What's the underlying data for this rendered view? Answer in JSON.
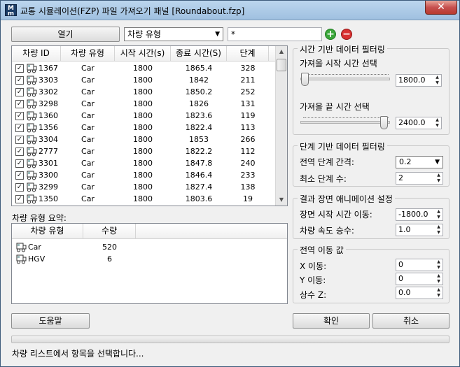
{
  "window": {
    "title": "교통 시뮬레이션(FZP) 파일 가져오기 패널 [Roundabout.fzp]",
    "close": "✕"
  },
  "toolbar": {
    "open_label": "열기",
    "filter_select": "차량 유형",
    "filter_text": "*",
    "add": "+",
    "remove": "−"
  },
  "vehicle_list": {
    "headers": [
      "차량 ID",
      "차량 유형",
      "시작 시간(s)",
      "종료 시간(S)",
      "단계"
    ],
    "rows": [
      {
        "id": "1367",
        "type": "Car",
        "start": "1800",
        "end": "1865.4",
        "steps": "328"
      },
      {
        "id": "3303",
        "type": "Car",
        "start": "1800",
        "end": "1842",
        "steps": "211"
      },
      {
        "id": "3302",
        "type": "Car",
        "start": "1800",
        "end": "1850.2",
        "steps": "252"
      },
      {
        "id": "3298",
        "type": "Car",
        "start": "1800",
        "end": "1826",
        "steps": "131"
      },
      {
        "id": "1360",
        "type": "Car",
        "start": "1800",
        "end": "1823.6",
        "steps": "119"
      },
      {
        "id": "1356",
        "type": "Car",
        "start": "1800",
        "end": "1822.4",
        "steps": "113"
      },
      {
        "id": "3304",
        "type": "Car",
        "start": "1800",
        "end": "1853",
        "steps": "266"
      },
      {
        "id": "2777",
        "type": "Car",
        "start": "1800",
        "end": "1822.2",
        "steps": "112"
      },
      {
        "id": "3301",
        "type": "Car",
        "start": "1800",
        "end": "1847.8",
        "steps": "240"
      },
      {
        "id": "3300",
        "type": "Car",
        "start": "1800",
        "end": "1846.4",
        "steps": "233"
      },
      {
        "id": "3299",
        "type": "Car",
        "start": "1800",
        "end": "1827.4",
        "steps": "138"
      },
      {
        "id": "1350",
        "type": "Car",
        "start": "1800",
        "end": "1803.6",
        "steps": "19"
      }
    ]
  },
  "summary": {
    "label": "차량 유형 요약:",
    "headers": [
      "차량 유형",
      "수량"
    ],
    "rows": [
      {
        "type": "Car",
        "count": "520"
      },
      {
        "type": "HGV",
        "count": "6"
      }
    ]
  },
  "time_filter": {
    "title": "시간 기반 데이터 필터링",
    "start_label": "가져올 시작 시간 선택",
    "start_value": "1800.0",
    "end_label": "가져올 끝 시간 선택",
    "end_value": "2400.0"
  },
  "step_filter": {
    "title": "단계 기반 데이터 필터링",
    "interval_label": "전역 단계 간격:",
    "interval_value": "0.2",
    "min_label": "최소 단계 수:",
    "min_value": "2"
  },
  "anim": {
    "title": "결과 장면 애니메이션 설정",
    "shift_label": "장면 시작 시간 이동:",
    "shift_value": "-1800.0",
    "speed_label": "차량 속도 승수:",
    "speed_value": "1.0"
  },
  "offset": {
    "title": "전역 이동 값",
    "x_label": "X 이동:",
    "x_value": "0",
    "y_label": "Y 이동:",
    "y_value": "0",
    "z_label": "상수 Z:",
    "z_value": "0.0"
  },
  "buttons": {
    "help": "도움말",
    "ok": "확인",
    "cancel": "취소"
  },
  "status": "차량 리스트에서 항목을 선택합니다..."
}
